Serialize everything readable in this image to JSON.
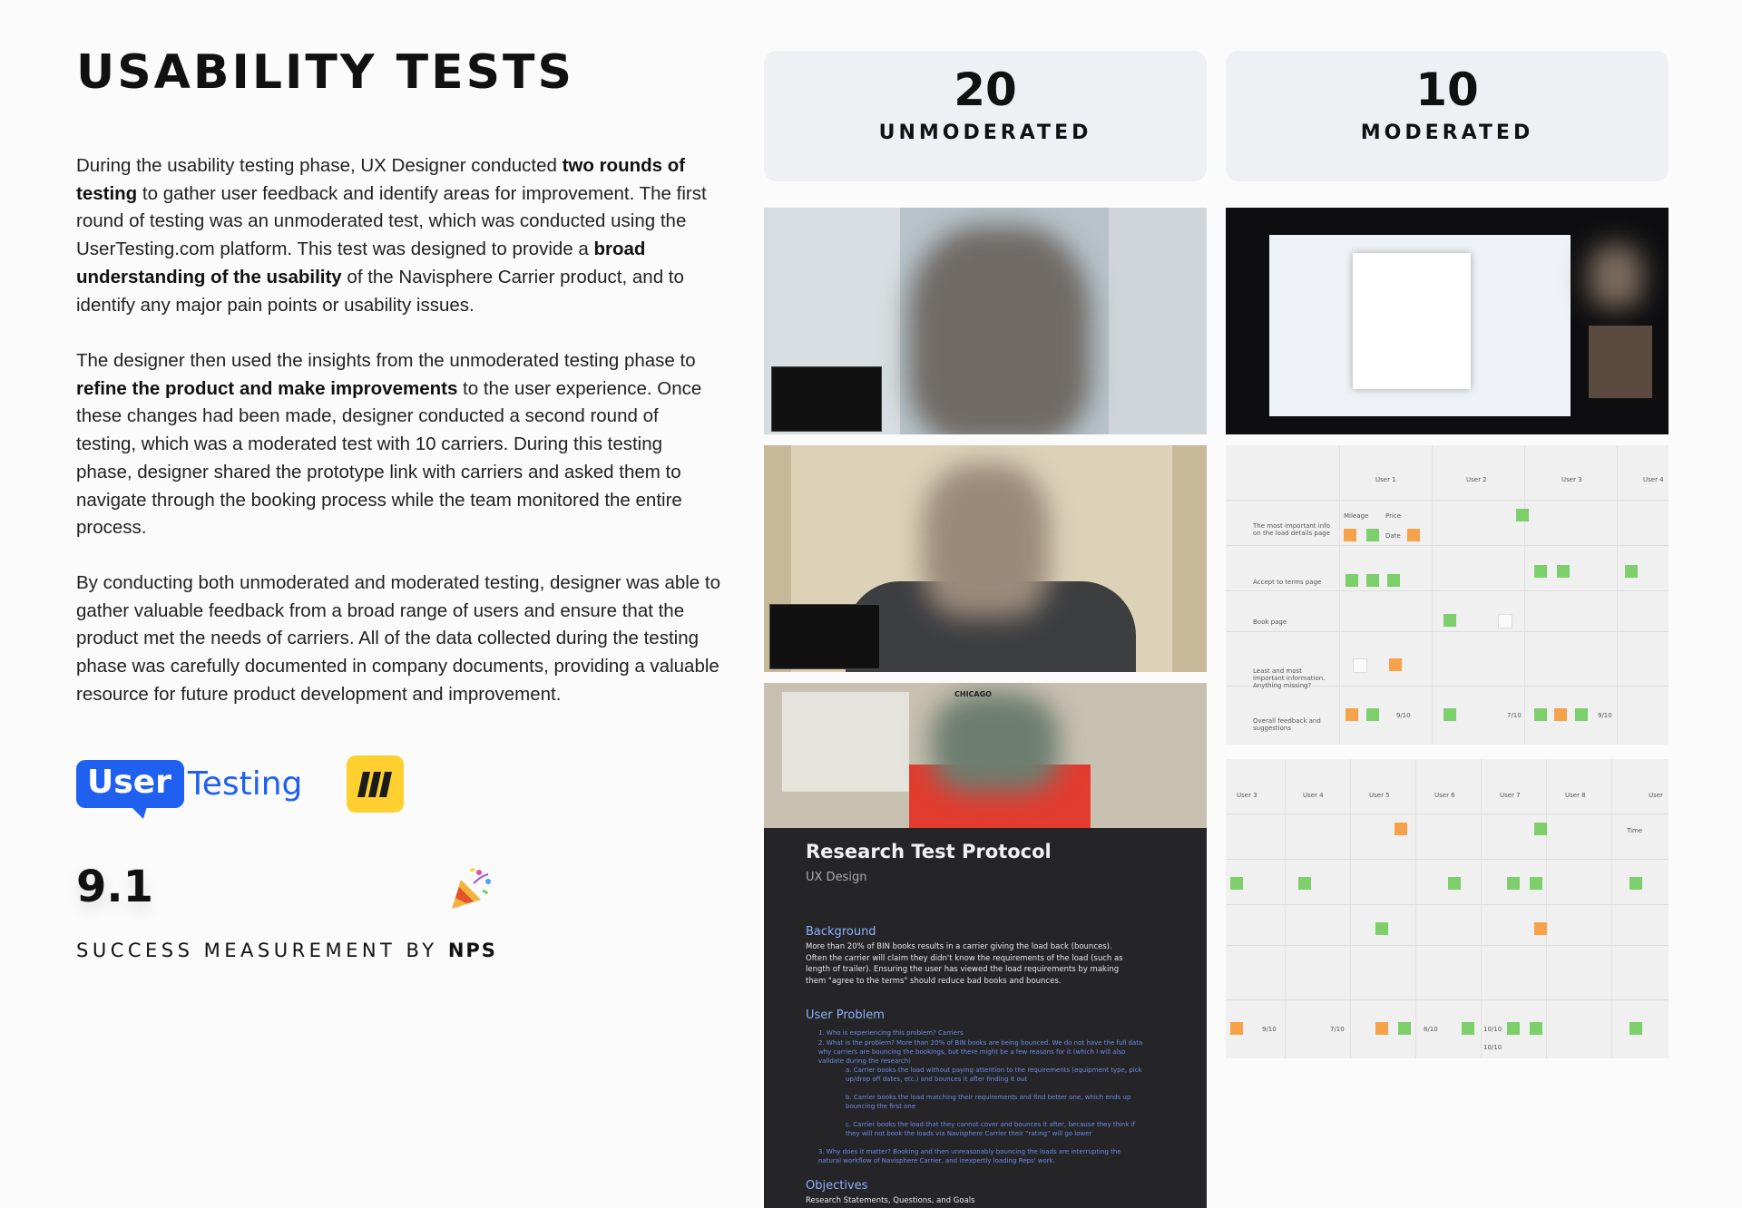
{
  "header": {
    "title": "USABILITY TESTS"
  },
  "intro": {
    "p1": [
      {
        "t": "During the usability testing phase, UX Designer conducted ",
        "b": false
      },
      {
        "t": "two rounds of testing",
        "b": true
      },
      {
        "t": " to gather user feedback and identify areas for improvement. The first round of testing was an unmoderated test, which was conducted using the UserTesting.com platform. This test was designed to provide a ",
        "b": false
      },
      {
        "t": "broad understanding of the usability",
        "b": true
      },
      {
        "t": " of the Navisphere Carrier product, and to identify any major pain points or usability issues.",
        "b": false
      }
    ],
    "p2": [
      {
        "t": "The designer then used the insights from the unmoderated testing phase to ",
        "b": false
      },
      {
        "t": "refine the product and make improvements",
        "b": true
      },
      {
        "t": " to the user experience. Once these changes had been made, designer conducted a second round of testing, which was a moderated test with 10 carriers. During this testing phase, designer shared the prototype link with carriers and asked them to navigate through the booking process while the team monitored the entire process.",
        "b": false
      }
    ],
    "p3": [
      {
        "t": "By conducting both unmoderated and moderated testing, designer was able to gather valuable feedback from a broad range of users and ensure that the product met the needs of carriers. All of the data collected during the testing phase was carefully documented in company documents, providing a valuable resource for future product development and improvement.",
        "b": false
      }
    ]
  },
  "logos": {
    "usertesting_user": "User",
    "usertesting_testing": "Testing",
    "miro_icon": "miro-logo"
  },
  "nps": {
    "score": "9.1",
    "label": "SUCCESS MEASUREMENT BY ",
    "label_bold": "NPS",
    "icon": "party-popper-icon"
  },
  "stats": [
    {
      "value": "20",
      "label": "UNMODERATED"
    },
    {
      "value": "10",
      "label": "MODERATED"
    }
  ],
  "board1": {
    "users": [
      "User 1",
      "User 2",
      "User 3",
      "User 4"
    ],
    "rows": [
      "The most important info on the load details page",
      "Accept to terms page",
      "Book page",
      "Least and most important information. Anything missing?",
      "Overall feedback and suggestions"
    ],
    "notes": [
      "Mileage",
      "Price",
      "Date",
      "9/10",
      "7/10",
      "9/10"
    ]
  },
  "board2": {
    "users": [
      "User 3",
      "User 4",
      "User 5",
      "User 6",
      "User 7",
      "User 8",
      "User"
    ],
    "notes": [
      "Time",
      "9/10",
      "7/10",
      "8/10",
      "10/10",
      "10/10"
    ]
  },
  "doc": {
    "title": "Research Test Protocol",
    "subtitle": "UX Design",
    "background_heading": "Background",
    "background_text": "More than 20% of BIN books results in a carrier giving the load back (bounces). Often the carrier will claim they didn't know the requirements of the load (such as length of trailer). Ensuring the user has viewed the load requirements by making them \"agree to the terms\" should reduce bad books and bounces.",
    "problem_heading": "User Problem",
    "problem_items": [
      "1.  Who is experiencing this problem? Carriers",
      "2.  What is the problem? More than 20% of BIN books are being bounced. We do not have the full data why carriers are bouncing the bookings, but there might be a few reasons for it (which I will also validate during the research)",
      "a.  Carrier books the load without paying attention to the requirements (equipment type, pick up/drop off dates, etc.) and bounces it after finding it out",
      "b.  Carrier books the load matching their requirements and find better one, which ends up bouncing the first one",
      "c.  Carrier books the load that they cannot cover and bounces it after, because they think if they will not book the loads via Navisphere Carrier their \"rating\" will go lower",
      "3.  Why does it matter? Booking and then unreasonably bouncing the loads are interrupting the natural workflow of Navisphere Carrier, and inexpertly loading Reps' work."
    ],
    "objectives_heading": "Objectives",
    "objectives_sub": "Research Statements, Questions, and Goals"
  },
  "icons": {
    "chicago_cap": "CHICAGO"
  }
}
